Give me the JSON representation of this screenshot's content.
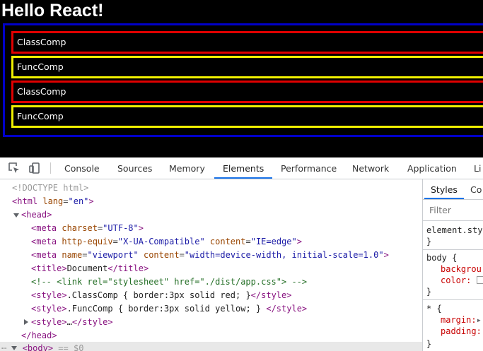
{
  "page": {
    "heading": "Hello React!",
    "components": [
      "ClassComp",
      "FuncComp",
      "ClassComp",
      "FuncComp"
    ],
    "colors": {
      "container_border": "#0000c8",
      "class_border": "#e00000",
      "func_border": "#f0f000"
    }
  },
  "devtools": {
    "icons": [
      "inspect-element-icon",
      "device-toggle-icon"
    ],
    "tabs": [
      "Console",
      "Sources",
      "Memory",
      "Elements",
      "Performance",
      "Network",
      "Application",
      "Li"
    ],
    "active_tab": "Elements",
    "dom": {
      "doctype": "<!DOCTYPE html>",
      "html_open": "<html",
      "html_lang_attr": "lang",
      "html_lang_val": "\"en\"",
      "head_open": "<head>",
      "meta1_attr": "charset",
      "meta1_val": "\"UTF-8\"",
      "meta2_attr1": "http-equiv",
      "meta2_val1": "\"X-UA-Compatible\"",
      "meta2_attr2": "content",
      "meta2_val2": "\"IE=edge\"",
      "meta3_attr1": "name",
      "meta3_val1": "\"viewport\"",
      "meta3_attr2": "content",
      "meta3_val2": "\"width=device-width, initial-scale=1.0\"",
      "title_text": "Document",
      "comment": "<!-- <link rel=\"stylesheet\" href=\"./dist/app.css\"> -->",
      "style1_text": ".ClassComp { border:3px solid red; }",
      "style2_text": ".FuncComp { border:3px solid yellow; }",
      "style3_collapsed": "…",
      "head_close": "</head>",
      "body_open": "<body>",
      "body_marker": "== $0"
    },
    "styles": {
      "tabs": [
        "Styles",
        "Co"
      ],
      "filter_placeholder": "Filter",
      "rule1_selector": "element.style {",
      "rule1_close": "}",
      "rule2_selector": "body {",
      "rule2_prop1": "backgrou",
      "rule2_prop2": "color:",
      "rule2_close": "}",
      "rule3_selector": "* {",
      "rule3_prop1": "margin:",
      "rule3_prop2": "padding:",
      "rule3_close": "}"
    }
  }
}
